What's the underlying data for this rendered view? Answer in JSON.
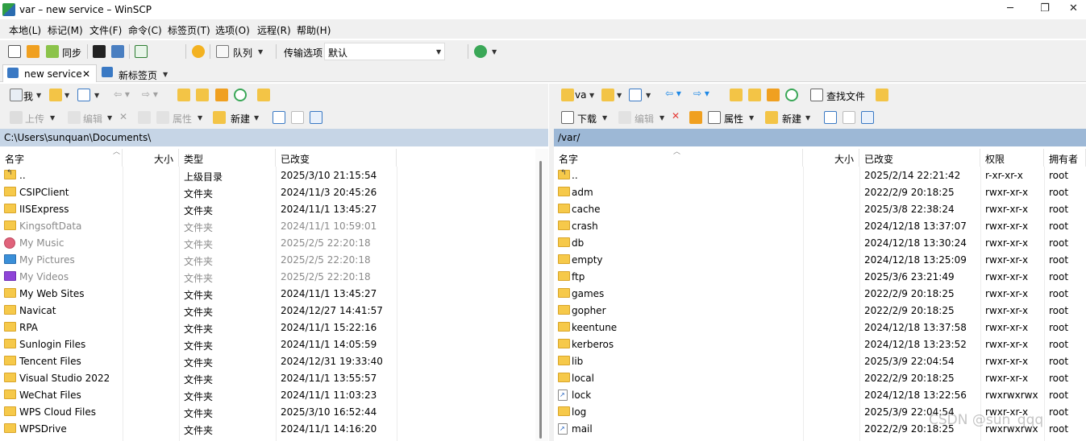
{
  "window": {
    "title": "var – new service – WinSCP",
    "minimize": "─",
    "maximize": "❐",
    "close": "✕"
  },
  "menu": [
    "本地(L)",
    "标记(M)",
    "文件(F)",
    "命令(C)",
    "标签页(T)",
    "选项(O)",
    "远程(R)",
    "帮助(H)"
  ],
  "toolbar": {
    "sync": "同步",
    "queue": "队列",
    "transfer_label": "传输选项",
    "transfer_value": "默认"
  },
  "tabs": [
    {
      "label": "new service",
      "close": "✕"
    },
    {
      "label": "新标签页"
    }
  ],
  "left_toolbar1": {
    "drive": "我"
  },
  "left_toolbar2": {
    "upload": "上传",
    "edit": "编辑",
    "properties": "属性",
    "new": "新建"
  },
  "right_toolbar1": {
    "drive": "va",
    "find": "查找文件"
  },
  "right_toolbar2": {
    "download": "下载",
    "edit": "编辑",
    "properties": "属性",
    "new": "新建"
  },
  "left_panel": {
    "path": "C:\\Users\\sunquan\\Documents\\",
    "columns": {
      "name": "名字",
      "size": "大小",
      "type": "类型",
      "changed": "已改变"
    },
    "rows": [
      {
        "name": "..",
        "type": "上级目录",
        "changed": "2025/3/10 21:15:54",
        "kind": "up"
      },
      {
        "name": "CSIPClient",
        "type": "文件夹",
        "changed": "2024/11/3 20:45:26",
        "kind": "folder"
      },
      {
        "name": "IISExpress",
        "type": "文件夹",
        "changed": "2024/11/1 13:45:27",
        "kind": "folder"
      },
      {
        "name": "KingsoftData",
        "type": "文件夹",
        "changed": "2024/11/1 10:59:01",
        "kind": "folder",
        "dim": true
      },
      {
        "name": "My Music",
        "type": "文件夹",
        "changed": "2025/2/5 22:20:18",
        "kind": "music",
        "dim": true
      },
      {
        "name": "My Pictures",
        "type": "文件夹",
        "changed": "2025/2/5 22:20:18",
        "kind": "pictures",
        "dim": true
      },
      {
        "name": "My Videos",
        "type": "文件夹",
        "changed": "2025/2/5 22:20:18",
        "kind": "videos",
        "dim": true
      },
      {
        "name": "My Web Sites",
        "type": "文件夹",
        "changed": "2024/11/1 13:45:27",
        "kind": "folder"
      },
      {
        "name": "Navicat",
        "type": "文件夹",
        "changed": "2024/12/27 14:41:57",
        "kind": "folder"
      },
      {
        "name": "RPA",
        "type": "文件夹",
        "changed": "2024/11/1 15:22:16",
        "kind": "folder"
      },
      {
        "name": "Sunlogin Files",
        "type": "文件夹",
        "changed": "2024/11/1 14:05:59",
        "kind": "folder"
      },
      {
        "name": "Tencent Files",
        "type": "文件夹",
        "changed": "2024/12/31 19:33:40",
        "kind": "folder"
      },
      {
        "name": "Visual Studio 2022",
        "type": "文件夹",
        "changed": "2024/11/1 13:55:57",
        "kind": "folder"
      },
      {
        "name": "WeChat Files",
        "type": "文件夹",
        "changed": "2024/11/1 11:03:23",
        "kind": "folder"
      },
      {
        "name": "WPS Cloud Files",
        "type": "文件夹",
        "changed": "2025/3/10 16:52:44",
        "kind": "folder"
      },
      {
        "name": "WPSDrive",
        "type": "文件夹",
        "changed": "2024/11/1 14:16:20",
        "kind": "folder"
      }
    ]
  },
  "right_panel": {
    "path": "/var/",
    "columns": {
      "name": "名字",
      "size": "大小",
      "changed": "已改变",
      "rights": "权限",
      "owner": "拥有者"
    },
    "rows": [
      {
        "name": "..",
        "changed": "2025/2/14 22:21:42",
        "rights": "r-xr-xr-x",
        "owner": "root",
        "kind": "up"
      },
      {
        "name": "adm",
        "changed": "2022/2/9 20:18:25",
        "rights": "rwxr-xr-x",
        "owner": "root",
        "kind": "folder"
      },
      {
        "name": "cache",
        "changed": "2025/3/8 22:38:24",
        "rights": "rwxr-xr-x",
        "owner": "root",
        "kind": "folder"
      },
      {
        "name": "crash",
        "changed": "2024/12/18 13:37:07",
        "rights": "rwxr-xr-x",
        "owner": "root",
        "kind": "folder"
      },
      {
        "name": "db",
        "changed": "2024/12/18 13:30:24",
        "rights": "rwxr-xr-x",
        "owner": "root",
        "kind": "folder"
      },
      {
        "name": "empty",
        "changed": "2024/12/18 13:25:09",
        "rights": "rwxr-xr-x",
        "owner": "root",
        "kind": "folder"
      },
      {
        "name": "ftp",
        "changed": "2025/3/6 23:21:49",
        "rights": "rwxr-xr-x",
        "owner": "root",
        "kind": "folder"
      },
      {
        "name": "games",
        "changed": "2022/2/9 20:18:25",
        "rights": "rwxr-xr-x",
        "owner": "root",
        "kind": "folder"
      },
      {
        "name": "gopher",
        "changed": "2022/2/9 20:18:25",
        "rights": "rwxr-xr-x",
        "owner": "root",
        "kind": "folder"
      },
      {
        "name": "keentune",
        "changed": "2024/12/18 13:37:58",
        "rights": "rwxr-xr-x",
        "owner": "root",
        "kind": "folder"
      },
      {
        "name": "kerberos",
        "changed": "2024/12/18 13:23:52",
        "rights": "rwxr-xr-x",
        "owner": "root",
        "kind": "folder"
      },
      {
        "name": "lib",
        "changed": "2025/3/9 22:04:54",
        "rights": "rwxr-xr-x",
        "owner": "root",
        "kind": "folder"
      },
      {
        "name": "local",
        "changed": "2022/2/9 20:18:25",
        "rights": "rwxr-xr-x",
        "owner": "root",
        "kind": "folder"
      },
      {
        "name": "lock",
        "changed": "2024/12/18 13:22:56",
        "rights": "rwxrwxrwx",
        "owner": "root",
        "kind": "link"
      },
      {
        "name": "log",
        "changed": "2025/3/9 22:04:54",
        "rights": "rwxr-xr-x",
        "owner": "root",
        "kind": "folder"
      },
      {
        "name": "mail",
        "changed": "2022/2/9 20:18:25",
        "rights": "rwxrwxrwx",
        "owner": "root",
        "kind": "link"
      }
    ]
  },
  "watermark": "CSDN @sun_qqq",
  "colors": {
    "path_left": "#c6d5e6",
    "path_right": "#9db8d6",
    "folder": "#f6c94a",
    "dim_text": "#8a8a8a"
  }
}
